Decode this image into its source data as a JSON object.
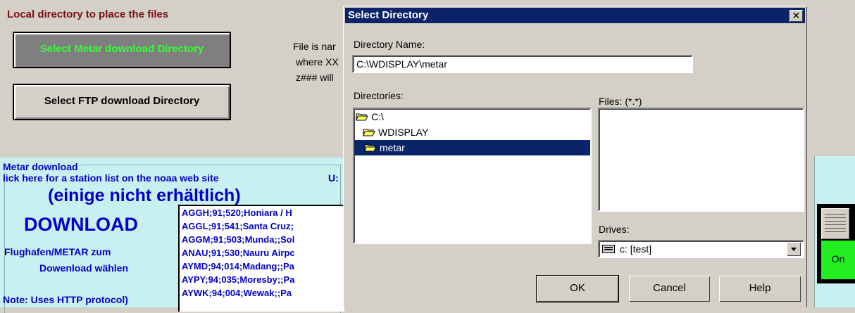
{
  "background_app": {
    "header": "Local directory to place the files",
    "select_metar_button": "Select Metar download Directory",
    "select_ftp_button": "Select FTP download  Directory",
    "file_info_lines": [
      "File is nar",
      "where XX",
      "z### will"
    ],
    "metar_group_label": "Metar download",
    "noaa_link": "lick here for a station list on the noaa web site",
    "u_label": "U:",
    "einige": "(einige nicht erhältlich)",
    "download": "DOWNLOAD",
    "flughafen_line1": "Flughafen/METAR zum",
    "flughafen_line2": "Dowenload wählen",
    "note": "Note: Uses HTTP protocol)",
    "station_list": [
      "AGGH;91;520;Honiara / H",
      "AGGL;91;541;Santa Cruz;",
      "AGGM;91;503;Munda;;Sol",
      "ANAU;91;530;Nauru Airpc",
      "AYMD;94;014;Madang;;Pa",
      "AYPY;94;035;Moresby;;Pa",
      "AYWK;94;004;Wewak;;Pa"
    ],
    "toggle_label": "On"
  },
  "dialog": {
    "title": "Select Directory",
    "close_glyph": "✕",
    "directory_name_label": "Directory Name:",
    "directory_name_value": "C:\\WDISPLAY\\metar",
    "directories_label": "Directories:",
    "directories": [
      "C:\\",
      "WDISPLAY",
      "metar"
    ],
    "files_label": "Files: (*.*)",
    "drives_label": "Drives:",
    "drive_value": "c: [test]",
    "ok_label": "OK",
    "cancel_label": "Cancel",
    "help_label": "Help"
  },
  "colors": {
    "titlebar": "#0a246a",
    "selection": "#0a246a",
    "metar_button_text": "#33ff33",
    "panel_bg": "#c8f0f0",
    "link_blue": "#0000cc",
    "header_red": "#7a1010",
    "toggle_green": "#22ee22"
  },
  "icons": [
    "folder-open-icon",
    "drive-icon",
    "dropdown-arrow-icon",
    "close-icon",
    "toggle-grip-icon"
  ]
}
